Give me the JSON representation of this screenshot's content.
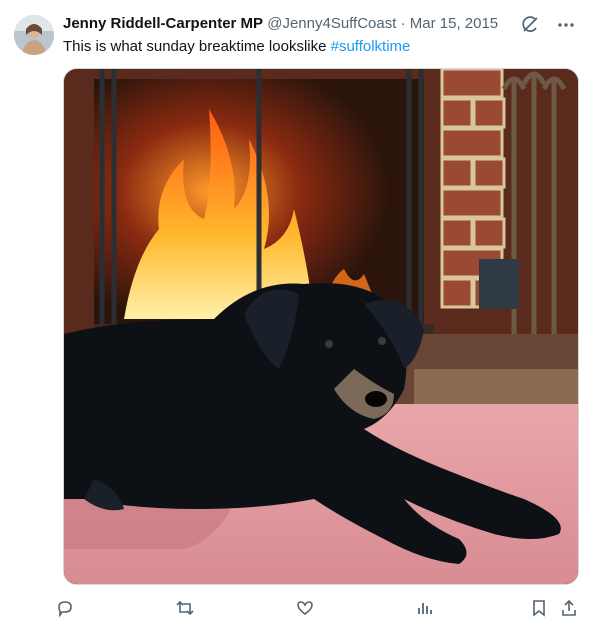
{
  "author": {
    "name": "Jenny Riddell-Carpenter MP",
    "handle": "@Jenny4SuffCoast",
    "separator": "·",
    "date": "Mar 15, 2015"
  },
  "post": {
    "text": "This is what sunday breaktime lookslike ",
    "hashtag": "#suffolktime"
  },
  "icons": {
    "grok": "grok-icon",
    "more": "more-icon",
    "reply": "reply-icon",
    "repost": "repost-icon",
    "like": "like-icon",
    "views": "views-icon",
    "bookmark": "bookmark-icon",
    "share": "share-icon"
  },
  "colors": {
    "link": "#1d9bf0",
    "secondary": "#536471",
    "text": "#0f1419"
  }
}
